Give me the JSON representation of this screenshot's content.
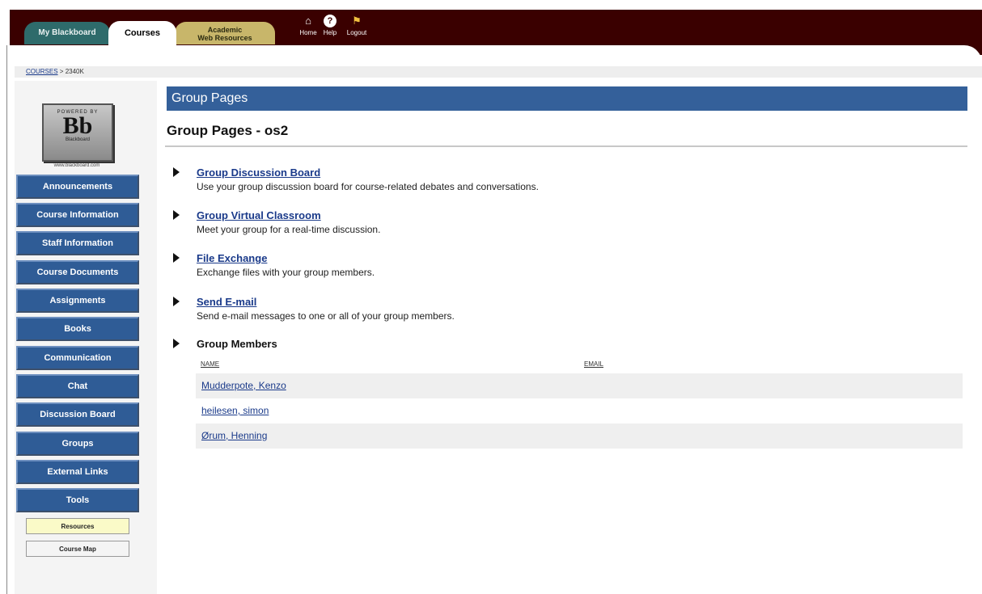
{
  "tabs": {
    "my_blackboard": "My Blackboard",
    "courses": "Courses",
    "academic_line1": "Academic",
    "academic_line2": "Web Resources"
  },
  "top_icons": {
    "home": "Home",
    "help": "Help",
    "logout": "Logout"
  },
  "breadcrumb": {
    "root": "COURSES",
    "separator": " > ",
    "current": "2340K"
  },
  "logo": {
    "powered_by": "POWERED BY",
    "mark": "Bb",
    "sub": "Blackboard",
    "url": "www.blackboard.com"
  },
  "nav": {
    "items": [
      "Announcements",
      "Course Information",
      "Staff Information",
      "Course Documents",
      "Assignments",
      "Books",
      "Communication",
      "Chat",
      "Discussion Board",
      "Groups",
      "External Links",
      "Tools"
    ],
    "resources": "Resources",
    "course_map": "Course Map"
  },
  "main": {
    "header": "Group Pages",
    "title": "Group Pages - os2",
    "items": [
      {
        "title": "Group Discussion Board",
        "desc": "Use your group discussion board for course-related debates and conversations."
      },
      {
        "title": "Group Virtual Classroom",
        "desc": "Meet your group for a real-time discussion."
      },
      {
        "title": "File Exchange",
        "desc": "Exchange files with your group members."
      },
      {
        "title": "Send E-mail",
        "desc": "Send e-mail messages to one or all of your group members."
      }
    ],
    "members_title": "Group Members",
    "members_columns": {
      "name": "NAME",
      "email": "EMAIL"
    },
    "members": [
      "Mudderpote, Kenzo",
      "heilesen, simon",
      "Ørum, Henning"
    ]
  },
  "colors": {
    "header_bg": "#3a0000",
    "nav_button": "#2f5c96",
    "title_bar": "#34609a",
    "link": "#1a3a8a"
  }
}
